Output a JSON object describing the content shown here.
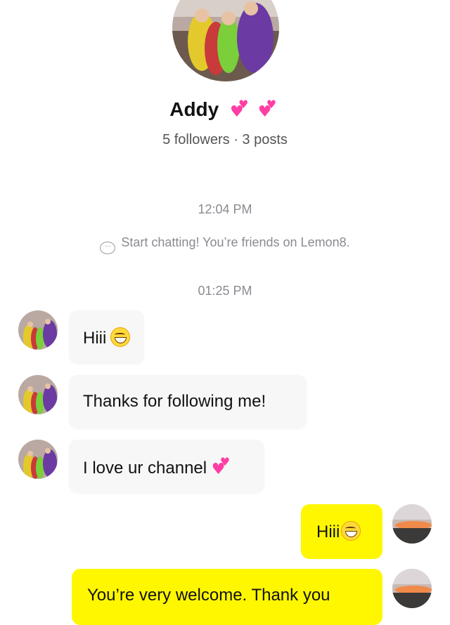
{
  "profile": {
    "name": "Addy",
    "name_emoji": "two-hearts-icon",
    "stats": "5 followers · 3 posts"
  },
  "chat": {
    "timestamp_1": "12:04 PM",
    "system_note": "Start chatting! You’re friends on Lemon8.",
    "timestamp_2": "01:25 PM",
    "messages": [
      {
        "sender": "other",
        "text": "Hiii",
        "emoji": "grinning-face-icon"
      },
      {
        "sender": "other",
        "text": "Thanks for following me!"
      },
      {
        "sender": "other",
        "text": "I love ur channel",
        "emoji": "two-hearts-icon"
      },
      {
        "sender": "me",
        "text": "Hiii",
        "emoji": "grinning-face-icon"
      },
      {
        "sender": "me",
        "text": "You’re very welcome. Thank you"
      }
    ]
  },
  "colors": {
    "outgoing_bubble": "#fff700",
    "incoming_bubble": "#f7f7f8",
    "muted_text": "#8a8b91"
  }
}
